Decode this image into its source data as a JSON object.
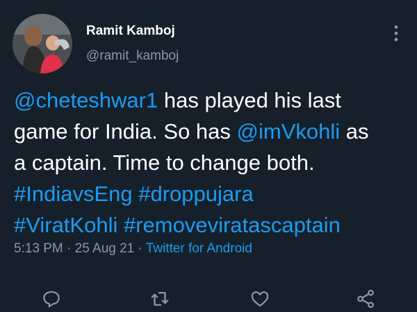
{
  "author": {
    "name": "Ramit Kamboj",
    "handle": "@ramit_kamboj"
  },
  "tweet": {
    "mention_pujara": "@cheteshwar1",
    "text_1": " has played his last",
    "text_2": "game for India. So has ",
    "mention_kohli": "@imVkohli",
    "text_3": " as",
    "text_4": "a captain. Time to change both.",
    "hashtag_1": "#IndiavsEng",
    "hashtag_2": "#droppujara",
    "hashtag_3": "#ViratKohli",
    "hashtag_4": "#removeviratascaptain"
  },
  "meta": {
    "time": "5:13 PM",
    "separator": " · ",
    "date": "25 Aug 21",
    "source": "Twitter for Android"
  },
  "actions": {
    "icons": [
      "reply-icon",
      "retweet-icon",
      "like-icon",
      "share-icon"
    ]
  },
  "colors": {
    "background": "#15202b",
    "link": "#1d9bf0",
    "secondary_text": "#8899a6",
    "primary_text": "#ffffff"
  }
}
